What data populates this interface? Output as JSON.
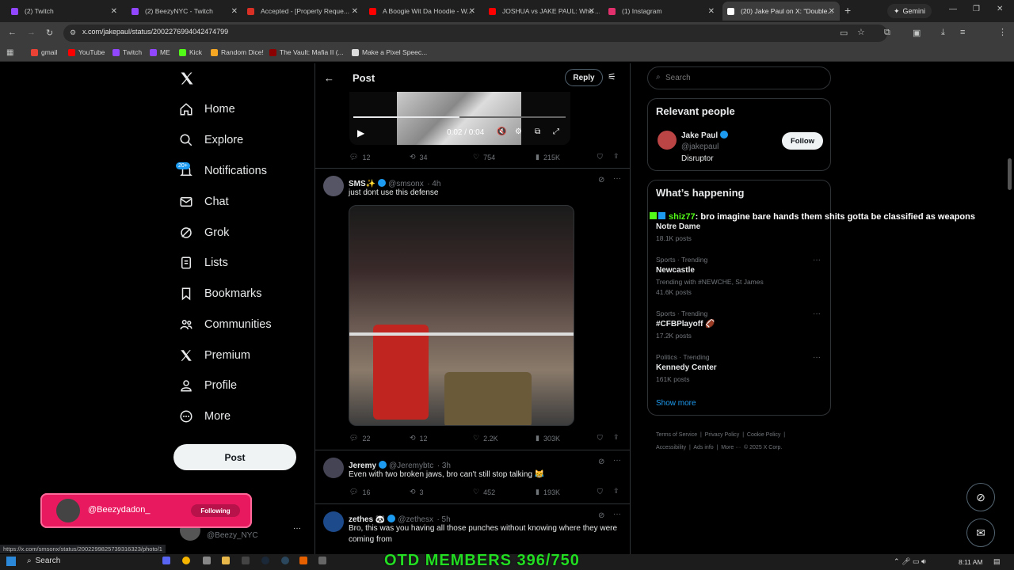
{
  "browser": {
    "tabs": [
      {
        "title": "(2) Twitch",
        "color": "#9146ff"
      },
      {
        "title": "(2) BeezyNYC - Twitch",
        "color": "#9146ff"
      },
      {
        "title": "Accepted - [Property Reque...",
        "color": "#d93025"
      },
      {
        "title": "A Boogie Wit Da Hoodie - W...",
        "color": "#ff0000"
      },
      {
        "title": "JOSHUA vs JAKE PAUL: Who ...",
        "color": "#ff0000"
      },
      {
        "title": "(1) Instagram",
        "color": "#e1306c"
      },
      {
        "title": "(20) Jake Paul on X: \"Double...",
        "color": "#ffffff"
      }
    ],
    "new_tab": "+",
    "gemini": "Gemini",
    "url": "x.com/jakepaul/status/2002276994042474799",
    "bookmarks": [
      {
        "label": "gmail",
        "color": "#ea4335"
      },
      {
        "label": "YouTube",
        "color": "#ff0000"
      },
      {
        "label": "Twitch",
        "color": "#9146ff"
      },
      {
        "label": "ME",
        "color": "#9146ff"
      },
      {
        "label": "Kick",
        "color": "#53fc18"
      },
      {
        "label": "Random Dice!",
        "color": "#f5a623"
      },
      {
        "label": "The Vault: Mafia II (...",
        "color": "#8b0000"
      },
      {
        "label": "Make a Pixel Speec...",
        "color": "#dddddd"
      }
    ],
    "status_url": "https://x.com/smsonx/status/2002299825739316323/photo/1"
  },
  "nav": {
    "items": [
      "Home",
      "Explore",
      "Notifications",
      "Chat",
      "Grok",
      "Lists",
      "Bookmarks",
      "Communities",
      "Premium",
      "Profile",
      "More"
    ],
    "notif_badge": "20+",
    "post_button": "Post",
    "account_handle": "@Beezy_NYC"
  },
  "header": {
    "title": "Post",
    "reply_button": "Reply"
  },
  "video": {
    "time": "0:02 / 0:04"
  },
  "post0_stats": {
    "replies": "12",
    "reposts": "34",
    "likes": "754",
    "views": "215K"
  },
  "posts": [
    {
      "name": "SMS✨",
      "handle": "@smsonx",
      "time": "· 4h",
      "text": "just dont use this defense",
      "replies": "22",
      "reposts": "12",
      "likes": "2.2K",
      "views": "303K"
    },
    {
      "name": "Jeremy",
      "handle": "@Jeremybtc",
      "time": "· 3h",
      "text": "Even with two broken jaws, bro can't still stop talking 😹",
      "replies": "16",
      "reposts": "3",
      "likes": "452",
      "views": "193K"
    },
    {
      "name": "zethes 🐼",
      "handle": "@zethesx",
      "time": "· 5h",
      "text": "Bro, this was you having all those punches without knowing where they were coming from"
    }
  ],
  "search": {
    "placeholder": "Search"
  },
  "relevant": {
    "title": "Relevant people",
    "name": "Jake Paul",
    "handle": "@jakepaul",
    "bio": "Disruptor",
    "follow": "Follow"
  },
  "happening": {
    "title": "What’s happening",
    "trends": [
      {
        "category": "",
        "title": "Notre Dame",
        "extra": "",
        "posts": "18.1K posts"
      },
      {
        "category": "Sports · Trending",
        "title": "Newcastle",
        "extra": "Trending with #NEWCHE, St James",
        "posts": "41.6K posts"
      },
      {
        "category": "Sports · Trending",
        "title": "#CFBPlayoff 🏈",
        "extra": "",
        "posts": "17.2K posts"
      },
      {
        "category": "Politics · Trending",
        "title": "Kennedy Center",
        "extra": "",
        "posts": "161K posts"
      }
    ],
    "show_more": "Show more"
  },
  "footer": [
    "Terms of Service",
    "|",
    "Privacy Policy",
    "|",
    "Cookie Policy",
    "|",
    "Accessibility",
    "|",
    "Ads info",
    "|",
    "More ···",
    "© 2025 X Corp."
  ],
  "overlay": {
    "chat_user": "shiz77",
    "chat_msg": "bro imagine bare hands them shits gotta be classified as weapons",
    "follow_handle": "@Beezydadon_",
    "follow_label": "Following",
    "members": "OTD MEMBERS 396/750"
  },
  "taskbar": {
    "search": "Search",
    "time": "8:11 AM"
  }
}
